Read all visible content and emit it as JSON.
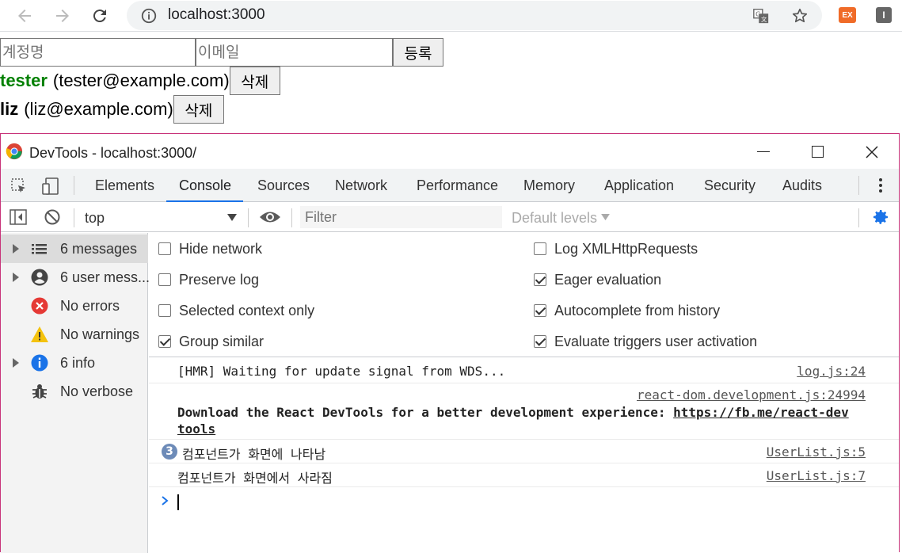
{
  "browser": {
    "url": "localhost:3000",
    "ext_label": "EX",
    "ext2_label": "I"
  },
  "app": {
    "username_placeholder": "계정명",
    "email_placeholder": "이메일",
    "register_label": "등록",
    "users": [
      {
        "username": "tester",
        "email": "(tester@example.com)",
        "delete_label": "삭제",
        "color": "#008000"
      },
      {
        "username": "liz",
        "email": "(liz@example.com)",
        "delete_label": "삭제",
        "color": "#000000"
      }
    ]
  },
  "devtools": {
    "window_title": "DevTools - localhost:3000/",
    "tabs": [
      "Elements",
      "Console",
      "Sources",
      "Network",
      "Performance",
      "Memory",
      "Application",
      "Security",
      "Audits"
    ],
    "active_tab": "Console",
    "context": "top",
    "filter_placeholder": "Filter",
    "levels": "Default levels",
    "sidebar": [
      {
        "label": "6 messages",
        "icon": "list-icon",
        "arrow": true,
        "selected": true
      },
      {
        "label": "6 user mess...",
        "icon": "user-icon",
        "arrow": true,
        "selected": false
      },
      {
        "label": "No errors",
        "icon": "error-icon",
        "arrow": false,
        "selected": false
      },
      {
        "label": "No warnings",
        "icon": "warning-icon",
        "arrow": false,
        "selected": false
      },
      {
        "label": "6 info",
        "icon": "info-icon",
        "arrow": true,
        "selected": false
      },
      {
        "label": "No verbose",
        "icon": "bug-icon",
        "arrow": false,
        "selected": false
      }
    ],
    "settings_left": [
      {
        "label": "Hide network",
        "checked": false
      },
      {
        "label": "Preserve log",
        "checked": false
      },
      {
        "label": "Selected context only",
        "checked": false
      },
      {
        "label": "Group similar",
        "checked": true
      }
    ],
    "settings_right": [
      {
        "label": "Log XMLHttpRequests",
        "checked": false
      },
      {
        "label": "Eager evaluation",
        "checked": true
      },
      {
        "label": "Autocomplete from history",
        "checked": true
      },
      {
        "label": "Evaluate triggers user activation",
        "checked": true
      }
    ],
    "messages": {
      "m1_text": "[HMR] Waiting for update signal from WDS...",
      "m1_source": "log.js:24",
      "m2_source": "react-dom.development.js:24994",
      "m2_text": "Download the React DevTools for a better development experience: ",
      "m2_link1": "https://fb.me/react-dev",
      "m2_link2": "tools",
      "m3_count": "3",
      "m3_text": "컴포넌트가 화면에 나타남",
      "m3_source": "UserList.js:5",
      "m4_text": "컴포넌트가 화면에서 사라짐",
      "m4_source": "UserList.js:7"
    }
  }
}
